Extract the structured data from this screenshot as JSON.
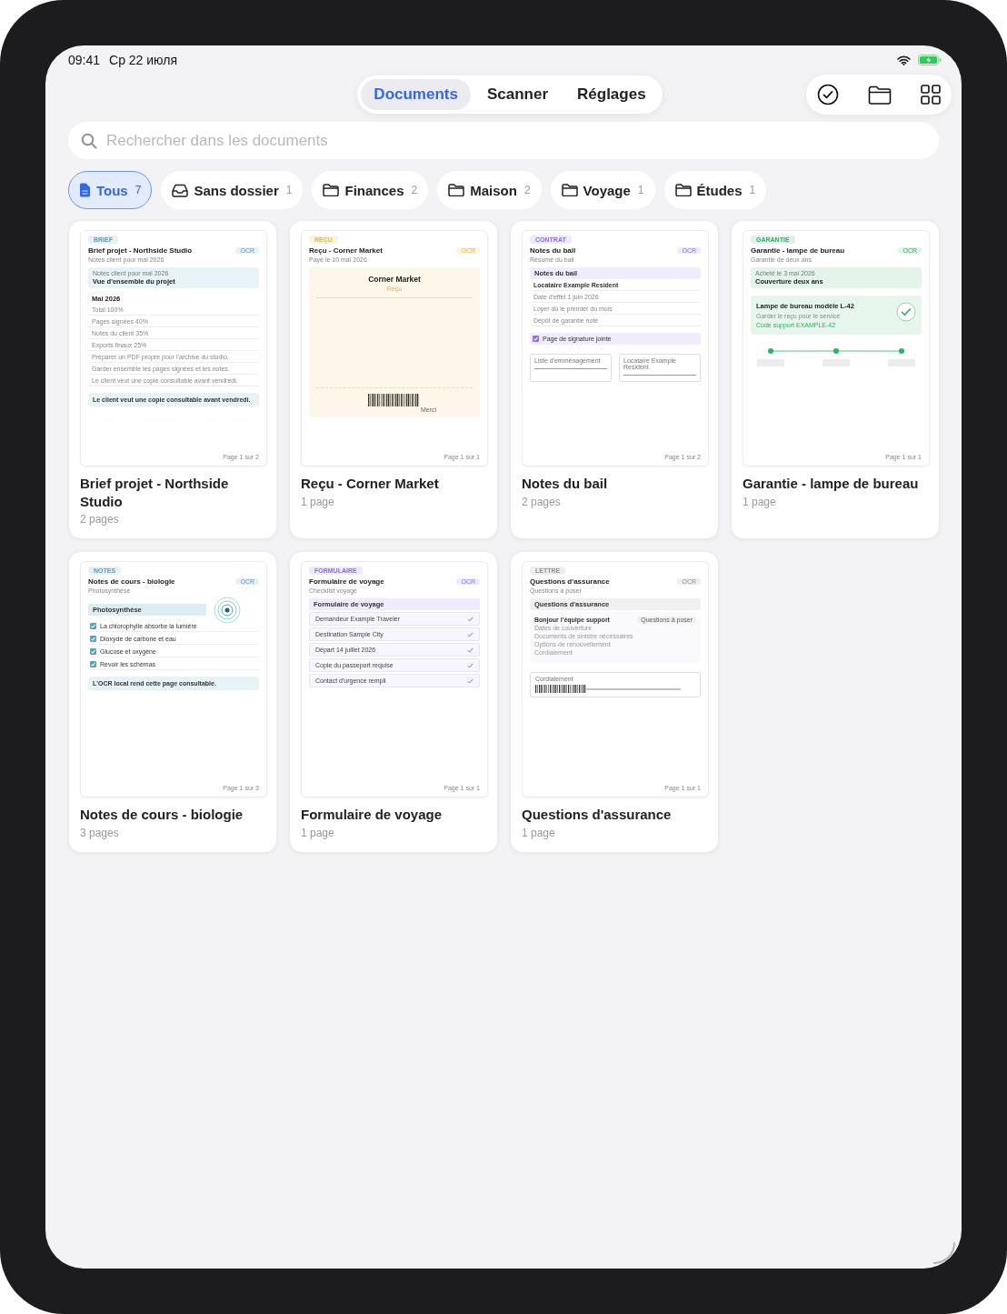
{
  "status_bar": {
    "time": "09:41",
    "date": "Ср 22 июля"
  },
  "tabs": [
    {
      "label": "Documents",
      "selected": true
    },
    {
      "label": "Scanner",
      "selected": false
    },
    {
      "label": "Réglages",
      "selected": false
    }
  ],
  "search": {
    "placeholder": "Rechercher dans les documents"
  },
  "filters": [
    {
      "kind": "all",
      "label": "Tous",
      "count": "7",
      "selected": true
    },
    {
      "kind": "inbox",
      "label": "Sans dossier",
      "count": "1",
      "selected": false
    },
    {
      "kind": "folder",
      "label": "Finances",
      "count": "2",
      "selected": false
    },
    {
      "kind": "folder",
      "label": "Maison",
      "count": "2",
      "selected": false
    },
    {
      "kind": "folder",
      "label": "Voyage",
      "count": "1",
      "selected": false
    },
    {
      "kind": "folder",
      "label": "Études",
      "count": "1",
      "selected": false
    }
  ],
  "documents": [
    {
      "name": "Brief projet - Northside Studio",
      "pages": "2 pages",
      "color": "#4fa3c4",
      "preview": {
        "tag": "BRIEF",
        "badge": "OCR",
        "title": "Brief projet - Northside Studio",
        "subtitle": "Notes client pour mai 2026",
        "footer": "Page 1 sur 2",
        "blocks": [
          {
            "kind": "callout",
            "label": "Notes client pour mai 2026",
            "text": "Vue d'ensemble du projet"
          },
          {
            "kind": "heading",
            "text": "Mai 2026"
          },
          {
            "kind": "row",
            "text": "Total 100%"
          },
          {
            "kind": "row",
            "text": "Pages signées 40%"
          },
          {
            "kind": "row",
            "text": "Notes du client 35%"
          },
          {
            "kind": "row",
            "text": "Exports finaux 25%"
          },
          {
            "kind": "row",
            "text": "Préparer un PDF propre pour l'archive du studio."
          },
          {
            "kind": "row",
            "text": "Garder ensemble les pages signées et les notes."
          },
          {
            "kind": "row",
            "text": "Le client veut une copie consultable avant vendredi."
          },
          {
            "kind": "note",
            "text": "Le client veut une copie consultable avant vendredi."
          }
        ]
      }
    },
    {
      "name": "Reçu - Corner Market",
      "pages": "1 page",
      "color": "#f0b429",
      "preview": {
        "tag": "REÇU",
        "badge": "OCR",
        "title": "Reçu - Corner Market",
        "subtitle": "Payé le 10 mai 2026",
        "footer": "Page 1 sur 1",
        "blocks": [
          {
            "kind": "receipt",
            "title": "Corner Market",
            "subtitle": "Reçu",
            "caption": "Merci"
          }
        ]
      }
    },
    {
      "name": "Notes du bail",
      "pages": "2 pages",
      "color": "#8b6cf0",
      "preview": {
        "tag": "CONTRAT",
        "badge": "OCR",
        "title": "Notes du bail",
        "subtitle": "Résumé du bail",
        "footer": "Page 1 sur 2",
        "blocks": [
          {
            "kind": "band",
            "text": "Notes du bail"
          },
          {
            "kind": "key-row",
            "text": "Locataire Example Resident"
          },
          {
            "kind": "row",
            "text": "Date d'effet 1 juin 2026"
          },
          {
            "kind": "row",
            "text": "Loyer dû le premier du mois"
          },
          {
            "kind": "row",
            "text": "Dépôt de garantie noté"
          },
          {
            "kind": "check-band",
            "text": "Page de signature jointe",
            "checked": true
          },
          {
            "kind": "fields",
            "labels": [
              "Liste d'emménagement",
              "Locataire Example Resident"
            ]
          }
        ]
      }
    },
    {
      "name": "Garantie - lampe de bureau",
      "pages": "1 page",
      "color": "#2fb166",
      "preview": {
        "tag": "GARANTIE",
        "badge": "OCR",
        "title": "Garantie - lampe de bureau",
        "subtitle": "Garantie de deux ans",
        "footer": "Page 1 sur 1",
        "blocks": [
          {
            "kind": "callout",
            "label": "Acheté le 3 mai 2026",
            "text": "Couverture deux ans"
          },
          {
            "kind": "product",
            "title": "Lampe de bureau modèle L-42",
            "note": "Garder le reçu pour le service",
            "code": "Code support EXAMPLE-42"
          },
          {
            "kind": "steps"
          }
        ]
      }
    },
    {
      "name": "Notes de cours - biologie",
      "pages": "3 pages",
      "color": "#4fa3c4",
      "preview": {
        "tag": "NOTES",
        "badge": "OCR",
        "title": "Notes de cours - biologie",
        "subtitle": "Photosynthèse",
        "footer": "Page 1 sur 3",
        "blocks": [
          {
            "kind": "focus-band",
            "text": "Photosynthèse"
          },
          {
            "kind": "check",
            "text": "La chlorophylle absorbe la lumière",
            "checked": true
          },
          {
            "kind": "check",
            "text": "Dioxyde de carbone et eau",
            "checked": true
          },
          {
            "kind": "check",
            "text": "Glucose et oxygène",
            "checked": true
          },
          {
            "kind": "check",
            "text": "Revoir les schémas",
            "checked": true
          },
          {
            "kind": "note",
            "text": "L'OCR local rend cette page consultable."
          }
        ]
      }
    },
    {
      "name": "Formulaire de voyage",
      "pages": "1 page",
      "color": "#8b6cf0",
      "preview": {
        "tag": "FORMULAIRE",
        "badge": "OCR",
        "title": "Formulaire de voyage",
        "subtitle": "Checklist voyage",
        "footer": "Page 1 sur 1",
        "blocks": [
          {
            "kind": "band",
            "text": "Formulaire de voyage"
          },
          {
            "kind": "form-row",
            "text": "Demandeur Example Traveler",
            "checked": true
          },
          {
            "kind": "form-row",
            "text": "Destination Sample City",
            "checked": true
          },
          {
            "kind": "form-row",
            "text": "Départ 14 juillet 2026",
            "checked": true
          },
          {
            "kind": "form-row",
            "text": "Copie du passeport requise",
            "checked": true
          },
          {
            "kind": "form-row",
            "text": "Contact d'urgence rempli",
            "checked": true
          }
        ]
      }
    },
    {
      "name": "Questions d'assurance",
      "pages": "1 page",
      "color": "#8e8e93",
      "preview": {
        "tag": "LETTRE",
        "badge": "OCR",
        "title": "Questions d'assurance",
        "subtitle": "Questions à poser",
        "footer": "Page 1 sur 1",
        "blocks": [
          {
            "kind": "band",
            "text": "Questions d'assurance"
          },
          {
            "kind": "letter",
            "greeting": "Bonjour l'équipe support",
            "tag": "Questions à poser",
            "lines": [
              "Dates de couverture",
              "Documents de sinistre nécessaires",
              "Options de renouvellement",
              "Cordialement"
            ]
          },
          {
            "kind": "signature",
            "label": "Cordialement"
          }
        ]
      }
    }
  ]
}
